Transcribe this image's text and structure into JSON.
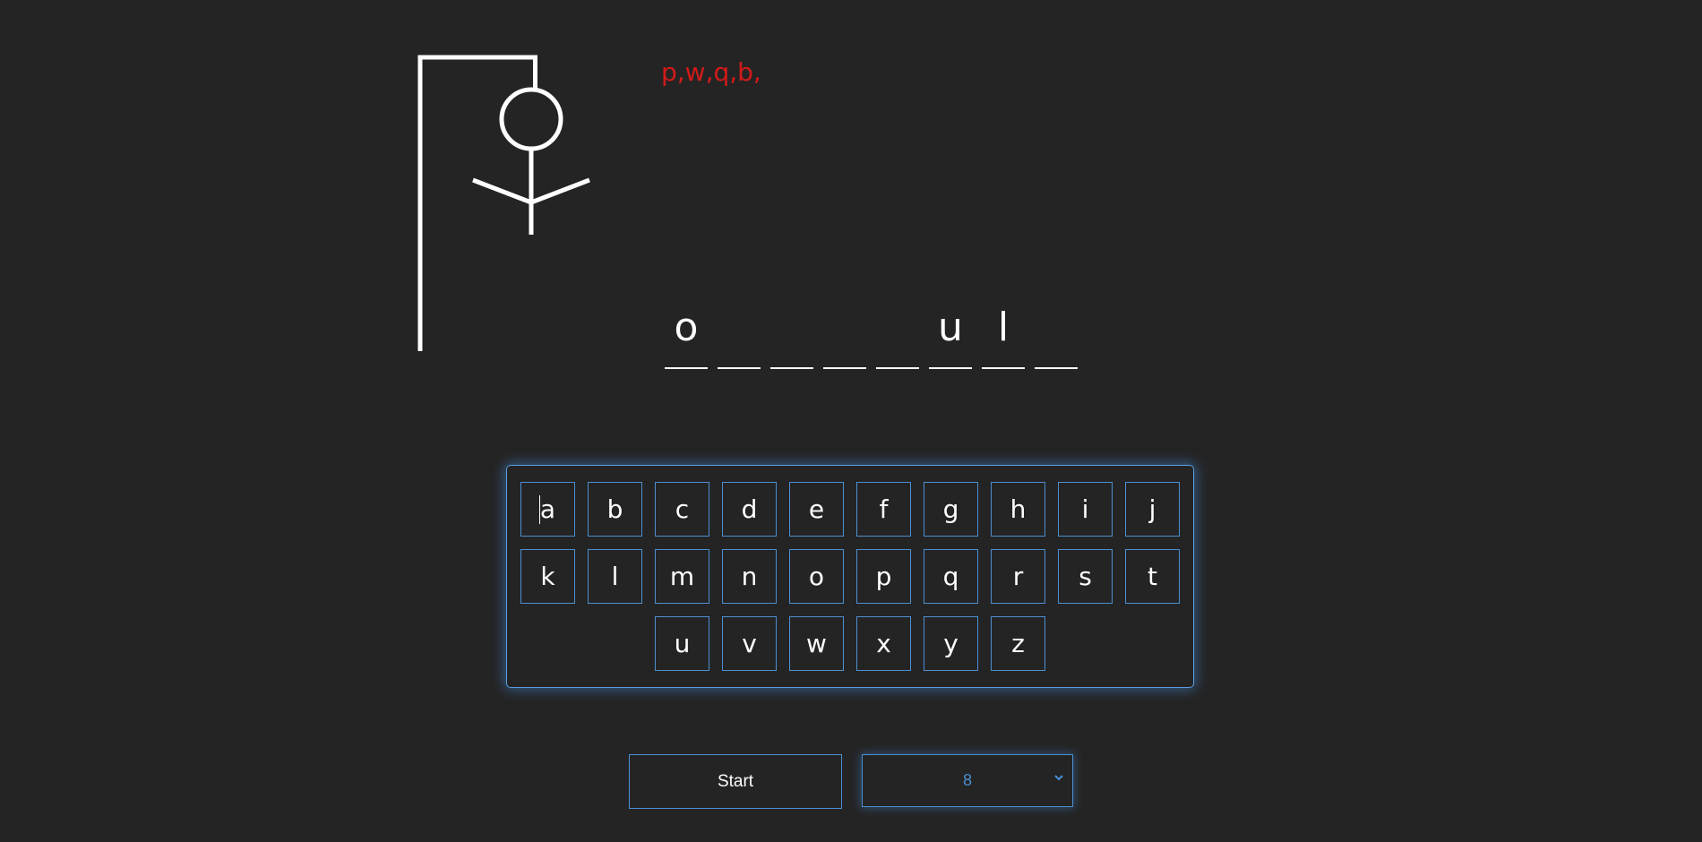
{
  "wrong_guesses": "p,w,q,b,",
  "word_slots": [
    "o",
    "",
    "",
    "",
    "",
    "u",
    "l",
    ""
  ],
  "keyboard": {
    "rows": [
      [
        "a",
        "b",
        "c",
        "d",
        "e",
        "f",
        "g",
        "h",
        "i",
        "j"
      ],
      [
        "k",
        "l",
        "m",
        "n",
        "o",
        "p",
        "q",
        "r",
        "s",
        "t"
      ],
      [
        "u",
        "v",
        "w",
        "x",
        "y",
        "z"
      ]
    ],
    "focused_key": "a"
  },
  "controls": {
    "start_label": "Start",
    "length_value": "8"
  },
  "colors": {
    "background": "#242424",
    "accent": "#4c8fd0",
    "wrong": "#d21a1a",
    "foreground": "#ffffff"
  },
  "icons": {
    "select_chevron": "chevron-down-icon"
  }
}
